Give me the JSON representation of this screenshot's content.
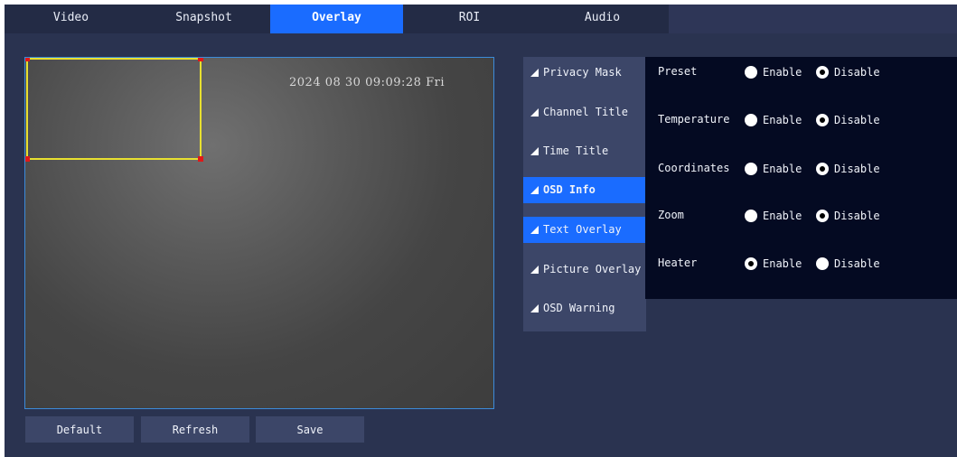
{
  "tabs": [
    "Video",
    "Snapshot",
    "Overlay",
    "ROI",
    "Audio"
  ],
  "active_tab": "Overlay",
  "preview": {
    "timestamp": "2024 08 30 09:09:28 Fri"
  },
  "buttons": {
    "default": "Default",
    "refresh": "Refresh",
    "save": "Save"
  },
  "menu": [
    {
      "label": "Privacy Mask"
    },
    {
      "label": "Channel Title"
    },
    {
      "label": "Time Title"
    },
    {
      "label": "OSD Info"
    },
    {
      "label": "Text Overlay"
    },
    {
      "label": "Picture Overlay"
    },
    {
      "label": "OSD Warning"
    }
  ],
  "menu_selected": [
    "OSD Info",
    "Text Overlay"
  ],
  "settings": [
    {
      "label": "Preset",
      "enable": "Enable",
      "disable": "Disable",
      "value": "Disable"
    },
    {
      "label": "Temperature",
      "enable": "Enable",
      "disable": "Disable",
      "value": "Disable"
    },
    {
      "label": "Coordinates",
      "enable": "Enable",
      "disable": "Disable",
      "value": "Disable"
    },
    {
      "label": "Zoom",
      "enable": "Enable",
      "disable": "Disable",
      "value": "Disable"
    },
    {
      "label": "Heater",
      "enable": "Enable",
      "disable": "Disable",
      "value": "Enable"
    }
  ],
  "colors": {
    "accent": "#1a6cff",
    "background": "#2a3350",
    "panel": "#040a22",
    "mask_border": "#e8e030",
    "handle": "#e01818"
  }
}
